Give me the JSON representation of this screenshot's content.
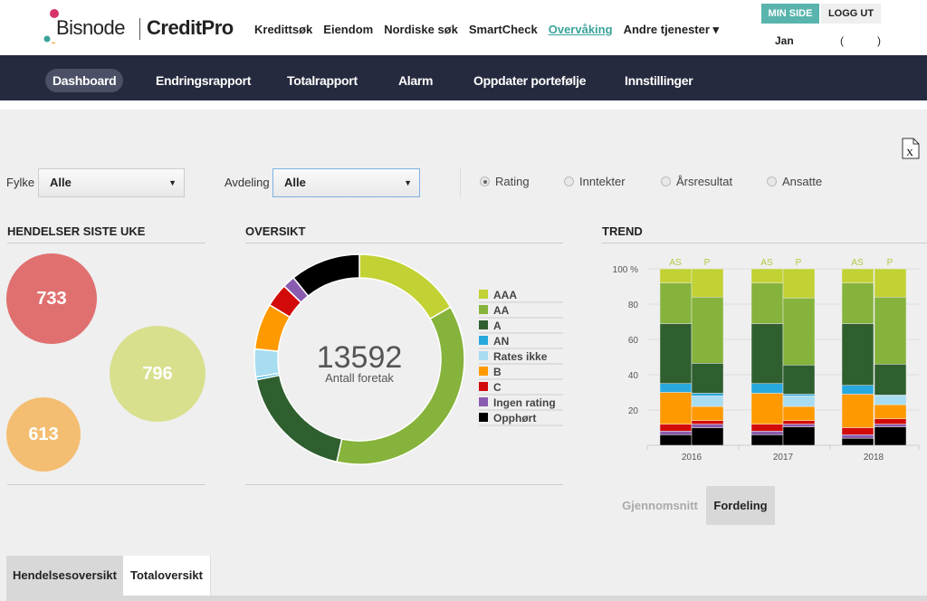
{
  "header": {
    "brand": "Bisnode",
    "product": "CreditPro",
    "nav": [
      {
        "label": "Kredittsøk"
      },
      {
        "label": "Eiendom"
      },
      {
        "label": "Nordiske søk"
      },
      {
        "label": "SmartCheck"
      },
      {
        "label": "Overvåking",
        "active": true
      },
      {
        "label": "Andre tjenester ▾"
      }
    ],
    "min_side": "MIN SIDE",
    "logg_ut": "LOGG UT",
    "user": "Jan",
    "paren_open": "(",
    "paren_close": ")"
  },
  "subnav": [
    {
      "label": "Dashboard",
      "active": true
    },
    {
      "label": "Endringsrapport"
    },
    {
      "label": "Totalrapport"
    },
    {
      "label": "Alarm"
    },
    {
      "label": "Oppdater portefølje"
    },
    {
      "label": "Innstillinger"
    }
  ],
  "filters": {
    "fylke_label": "Fylke",
    "fylke_value": "Alle",
    "avdeling_label": "Avdeling",
    "avdeling_value": "Alle",
    "radios": [
      {
        "label": "Rating",
        "checked": true
      },
      {
        "label": "Inntekter"
      },
      {
        "label": "Årsresultat"
      },
      {
        "label": "Ansatte"
      }
    ],
    "export_icon": "excel-file-icon"
  },
  "events": {
    "title": "HENDELSER SISTE UKE",
    "bubbles": [
      {
        "value": "733",
        "color": "#e07070"
      },
      {
        "value": "796",
        "color": "#d8e08e"
      },
      {
        "value": "613",
        "color": "#f4be72"
      }
    ]
  },
  "overview": {
    "title": "OVERSIKT",
    "total": "13592",
    "total_label": "Antall foretak"
  },
  "trend": {
    "title": "TREND",
    "tabs": [
      {
        "label": "Gjennomsnitt"
      },
      {
        "label": "Fordeling",
        "active": true
      }
    ]
  },
  "bottom_tabs": [
    {
      "label": "Hendelsesoversikt",
      "active": true
    },
    {
      "label": "Totaloversikt"
    }
  ],
  "chart_data": [
    {
      "type": "pie",
      "title": "OVERSIKT",
      "donut": true,
      "legend": "right",
      "categories": [
        "AAA",
        "AA",
        "A",
        "AN",
        "Rates ikke",
        "B",
        "C",
        "Ingen rating",
        "Opphørt"
      ],
      "colors": [
        "#c2d133",
        "#86b33b",
        "#2f5f2f",
        "#29a8de",
        "#a8dcf0",
        "#ff9900",
        "#d20a0a",
        "#8a5cb0",
        "#000000"
      ],
      "values": [
        16.7,
        36.7,
        18.4,
        0.4,
        4.3,
        7.1,
        3.6,
        1.9,
        10.8
      ]
    },
    {
      "type": "bar",
      "stacked": true,
      "title": "TREND",
      "ylim": [
        0,
        100
      ],
      "yticks": [
        "20",
        "40",
        "60",
        "80",
        "100 %"
      ],
      "grid": true,
      "categories": [
        "2016",
        "2017",
        "2018"
      ],
      "subcategories": [
        "AS",
        "P"
      ],
      "series_order": [
        "Opphørt",
        "Ingen rating",
        "C",
        "B",
        "Rates ikke",
        "AN",
        "A",
        "AA",
        "AAA"
      ],
      "colors": [
        "#000000",
        "#8a5cb0",
        "#d20a0a",
        "#ff9900",
        "#a8dcf0",
        "#29a8de",
        "#2f5f2f",
        "#86b33b",
        "#c2d133"
      ],
      "bars": [
        {
          "year": "2016",
          "group": "AS",
          "values": [
            6,
            2,
            4,
            18,
            0,
            5,
            34,
            23,
            8
          ]
        },
        {
          "year": "2016",
          "group": "P",
          "values": [
            10,
            2,
            2,
            8,
            6,
            1.5,
            17,
            37.5,
            16
          ]
        },
        {
          "year": "2017",
          "group": "AS",
          "values": [
            6,
            2,
            4,
            17.5,
            0,
            5.5,
            34,
            23,
            8
          ]
        },
        {
          "year": "2017",
          "group": "P",
          "values": [
            10.5,
            1.5,
            2,
            8,
            6,
            1,
            16.5,
            38,
            16.5
          ]
        },
        {
          "year": "2018",
          "group": "AS",
          "values": [
            4,
            2,
            4,
            19,
            0,
            5,
            35,
            23,
            8
          ]
        },
        {
          "year": "2018",
          "group": "P",
          "values": [
            10.5,
            1.5,
            3,
            8,
            5,
            0.5,
            17.5,
            38,
            16
          ]
        }
      ]
    }
  ]
}
